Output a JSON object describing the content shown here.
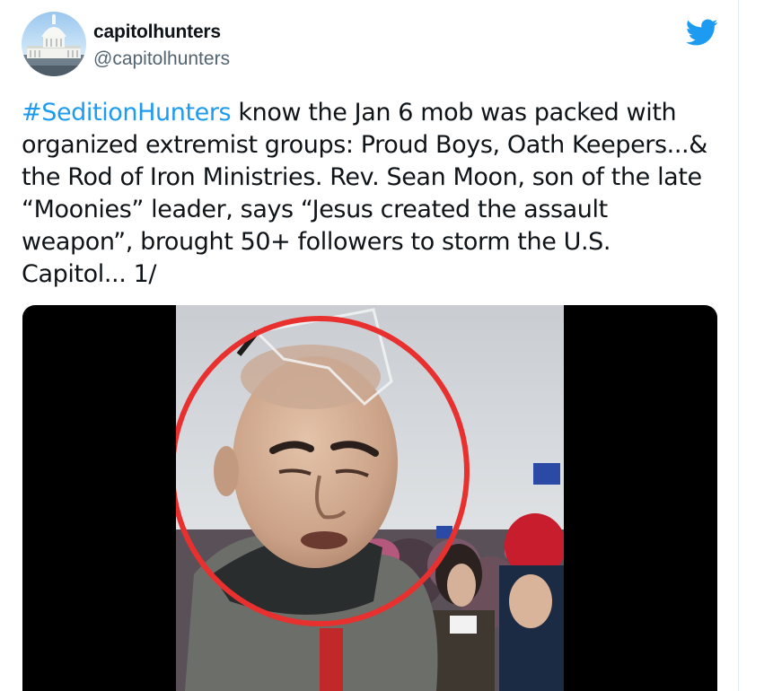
{
  "tweet": {
    "display_name": "capitolhunters",
    "handle": "@capitolhunters",
    "hashtag": "#SeditionHunters",
    "lines": [
      " know the Jan 6 mob was packed with",
      "organized extremist groups: Proud Boys, Oath Keepers...&",
      "the Rod of Iron Ministries. Rev. Sean Moon, son of the late",
      "“Moonies” leader, says “Jesus created the assault",
      "weapon”, brought 50+ followers to storm the U.S.",
      "Capitol... 1/"
    ]
  },
  "icons": {
    "brand": "twitter-bird-icon",
    "avatar": "capitol-building-avatar"
  },
  "colors": {
    "link": "#1d9bf0",
    "text": "#0f1419",
    "secondary": "#536471",
    "twitter_blue": "#1d9bf0",
    "highlight_circle": "#e8302f"
  }
}
